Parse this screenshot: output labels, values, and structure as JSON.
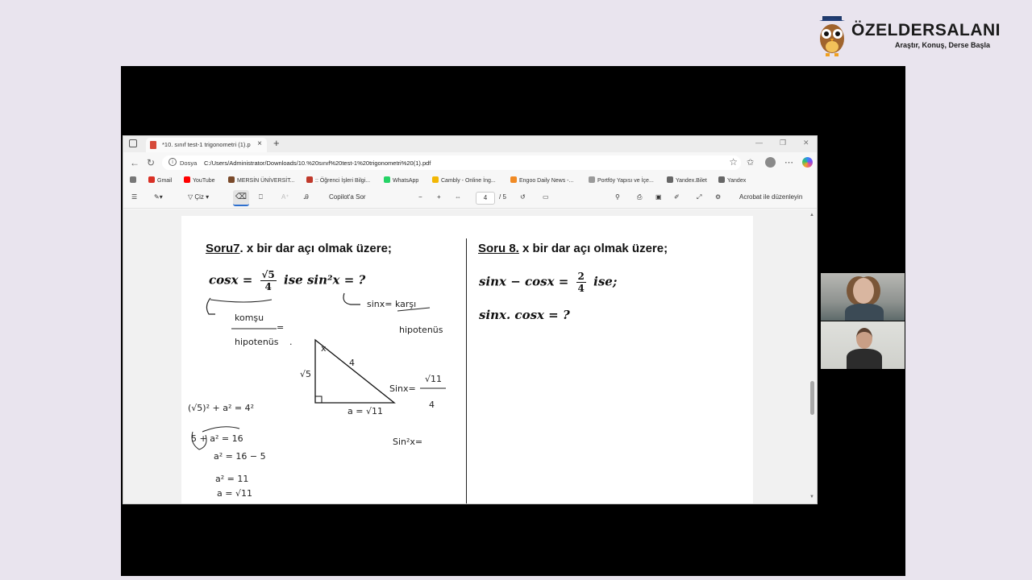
{
  "logo": {
    "brand": "ÖZELDERSALANI",
    "tagline": "Araştır, Konuş, Derse Başla"
  },
  "browser": {
    "tab_title": "*10. sınıf test-1 trigonometri (1).p",
    "url_protocol": "Dosya",
    "url": "C:/Users/Administrator/Downloads/10.%20sınıf%20test-1%20trigonometri%20(1).pdf",
    "favorites": [
      {
        "label": "Gmail",
        "color": "#d93025"
      },
      {
        "label": "YouTube",
        "color": "#ff0000"
      },
      {
        "label": "MERSİN ÜNİVERSİT...",
        "color": "#7a4a2a"
      },
      {
        "label": ":: Öğrenci İşleri Bilgi...",
        "color": "#c0392b"
      },
      {
        "label": "WhatsApp",
        "color": "#25d366"
      },
      {
        "label": "Cambly - Online İng...",
        "color": "#f2b705"
      },
      {
        "label": "Engoo Daily News -...",
        "color": "#f08a24"
      },
      {
        "label": "Portföy Yapısı ve İçe...",
        "color": "#9a9a9a"
      },
      {
        "label": "Yandex.Bilet",
        "color": "#666666"
      },
      {
        "label": "Yandex",
        "color": "#666666"
      }
    ]
  },
  "pdf_toolbar": {
    "draw_label": "Çiz",
    "copilot_label": "Copilot'a Sor",
    "zoom_out": "−",
    "zoom_in": "+",
    "page_current": "4",
    "page_total": "/ 5",
    "acrobat_label": "Acrobat ile düzenleyin"
  },
  "document": {
    "q7": {
      "head_label": "Soru7",
      "head_text": ". x bir dar açı olmak üzere;",
      "eq_lhs": "cosx = ",
      "eq_num": "√5",
      "eq_den": "4",
      "eq_rhs": "ise   sin²x = ?"
    },
    "q8": {
      "head_label": "Soru 8.",
      "head_text": "x bir dar açı olmak üzere;",
      "eq_lhs": "sinx − cosx = ",
      "eq_num": "2",
      "eq_den": "4",
      "eq_rhs": "ise;",
      "line2": "sinx. cosx = ?"
    },
    "handwriting": {
      "komsu": "komşu",
      "eq": "=",
      "hipotenus": "hipotenüs",
      "dot": ".",
      "sinx_karsi": "sinx= karşı",
      "hipotenus2": "hipotenüs",
      "tri_x": "x",
      "tri_4": "4",
      "tri_sqrt5": "√5",
      "tri_a": "a = √11",
      "sinx_eq": "Sinx=",
      "sqrt11": "√11",
      "four": "4",
      "pyth": "(√5)² + a² = 4²",
      "step1": "5 + a² = 16",
      "step2": "a² = 16 − 5",
      "step3": "a² = 11",
      "step4": "a = √11",
      "sin2x": "Sin²x="
    }
  },
  "colors": {
    "background": "#e9e4ee",
    "screen": "#000000",
    "accent_blue": "#2d6fce"
  }
}
